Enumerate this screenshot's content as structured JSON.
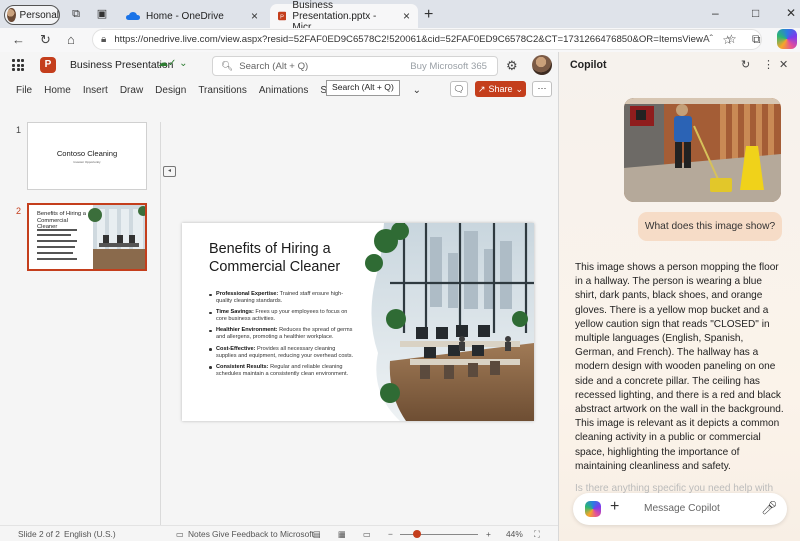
{
  "browser": {
    "profile_label": "Personal",
    "tabs": [
      {
        "title": "Home - OneDrive"
      },
      {
        "title": "Business Presentation.pptx - Micr"
      }
    ],
    "url": "https://onedrive.live.com/view.aspx?resid=52FAF0ED9C6578C2!520061&cid=52FAF0ED9C6578C2&CT=1731266476850&OR=ItemsView"
  },
  "app": {
    "doc_title": "Business Presentation",
    "search_placeholder": "Search (Alt + Q)",
    "buy_label": "Buy Microsoft 365",
    "tooltip": "Search (Alt + Q)",
    "ribbon": [
      "File",
      "Home",
      "Insert",
      "Draw",
      "Design",
      "Transitions",
      "Animations",
      "Slide"
    ],
    "share_label": "Share",
    "accent": "#c43e1c"
  },
  "thumbnails": [
    {
      "number": "1",
      "title": "Contoso Cleaning",
      "subtitle": "Investor Opportunity"
    },
    {
      "number": "2",
      "title": "Benefits of Hiring a Commercial Cleaner"
    }
  ],
  "slide": {
    "title": "Benefits of Hiring a Commercial Cleaner",
    "bullets": [
      {
        "label": "Professional Expertise:",
        "text": " Trained staff ensure high-quality cleaning standards."
      },
      {
        "label": "Time Savings:",
        "text": " Frees up your employees to focus on core business activities."
      },
      {
        "label": "Healthier Environment:",
        "text": " Reduces the spread of germs and allergens, promoting a healthier workplace."
      },
      {
        "label": "Cost-Effective:",
        "text": " Provides all necessary cleaning supplies and equipment, reducing your overhead costs."
      },
      {
        "label": "Consistent Results:",
        "text": " Regular and reliable cleaning schedules maintain a consistently clean environment."
      }
    ]
  },
  "status": {
    "slide_info": "Slide 2 of 2",
    "language": "English (U.S.)",
    "notes": "Notes",
    "feedback": "Give Feedback to Microsoft",
    "zoom": "44%"
  },
  "copilot": {
    "title": "Copilot",
    "user_message": "What does this image show?",
    "reply": "This image shows a person mopping the floor in a hallway. The person is wearing a blue shirt, dark pants, black shoes, and orange gloves. There is a yellow mop bucket and a yellow caution sign that reads \"CLOSED\" in multiple languages (English, Spanish, German, and French). The hallway has a modern design with wooden paneling on one side and a concrete pillar. The ceiling has recessed lighting, and there is a red and black abstract artwork on the wall in the background. This image is relevant as it depicts a common cleaning activity in a public or commercial space, highlighting the importance of maintaining cleanliness and safety.",
    "followup": "Is there anything specific you need help with",
    "input_placeholder": "Message Copilot"
  }
}
